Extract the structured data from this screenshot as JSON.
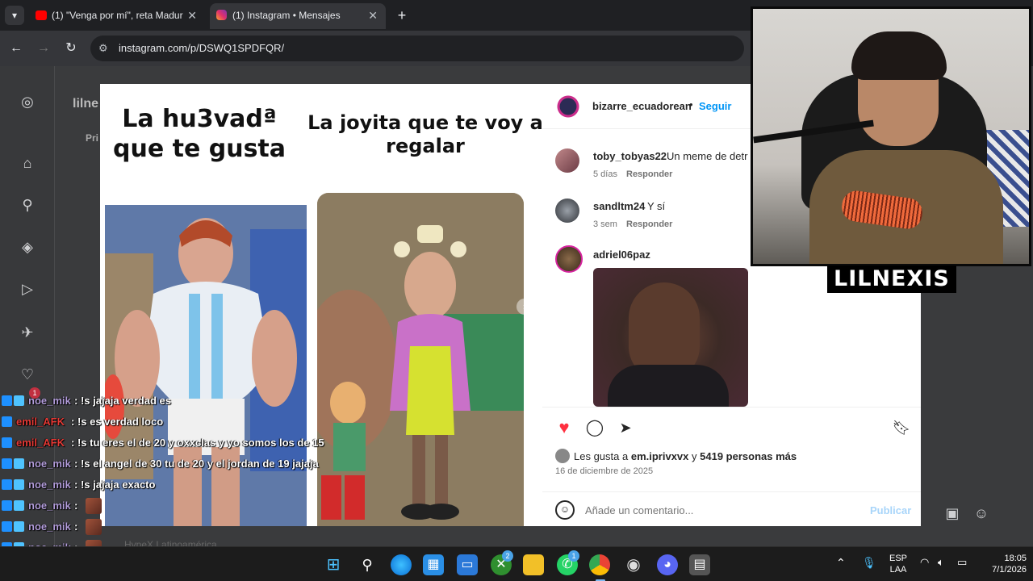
{
  "browser": {
    "tabs": [
      {
        "label": "(1) \"Venga por mí\", reta Madur"
      },
      {
        "label": "(1) Instagram • Mensajes"
      }
    ],
    "url": "instagram.com/p/DSWQ1SPDFQR/"
  },
  "background": {
    "title": "lilne",
    "tab": "Pri",
    "footer": "HypeX Latinoamérica"
  },
  "post": {
    "meme": {
      "caption_left": "La hu3vadª que te gusta",
      "caption_right": "La joyita que te voy a regalar"
    },
    "header": {
      "username": "bizarre_ecuadorean",
      "separator": "•",
      "follow": "Seguir"
    },
    "comments": [
      {
        "user": "toby_tobyas22",
        "text": "Un meme de detr",
        "time": "5 días",
        "reply": "Responder"
      },
      {
        "user": "sandltm24",
        "text": "Y sí",
        "time": "3 sem",
        "reply": "Responder"
      },
      {
        "user": "adriel06paz",
        "text": "",
        "time": "",
        "reply": ""
      }
    ],
    "likes": {
      "prefix": "Les gusta a",
      "user": "em.iprivxvx",
      "middle": "y",
      "others": "5419 personas más"
    },
    "date": "16 de diciembre de 2025",
    "comment_placeholder": "Añade un comentario...",
    "publish": "Publicar"
  },
  "sidebar": {
    "notification_count": "1"
  },
  "streamer": {
    "name": "LILNEXIS"
  },
  "chat": [
    {
      "user": "noe_mik",
      "text": ": !s jajaja verdad es",
      "color": "#b39ddb"
    },
    {
      "user": "emil_AFK",
      "text": ": !s es verdad loco",
      "color": "#e53935"
    },
    {
      "user": "emil_AFK",
      "text": ": !s tu eres el de 20 y oxxclas y yo somos los de 15",
      "color": "#e53935"
    },
    {
      "user": "noe_mik",
      "text": ": !s el angel de 30 tu de 20 y el jordan de 19 jajaja",
      "color": "#b39ddb"
    },
    {
      "user": "noe_mik",
      "text": ": !s jajaja exacto",
      "color": "#b39ddb"
    },
    {
      "user": "noe_mik",
      "text": ":",
      "color": "#b39ddb"
    },
    {
      "user": "noe_mik",
      "text": ":",
      "color": "#b39ddb"
    },
    {
      "user": "noe_mik",
      "text": ":",
      "color": "#b39ddb"
    },
    {
      "user": "noe_mik",
      "text": ":",
      "color": "#b39ddb"
    }
  ],
  "taskbar": {
    "xbox_badge": "2",
    "whatsapp_badge": "1",
    "lang": "ESP",
    "layout": "LAA",
    "time": "18:05",
    "date": "7/1/2026"
  },
  "colors": {
    "instagram_blue": "#0095f6",
    "like_red": "#ff3040",
    "chrome_dark": "#35363a"
  }
}
